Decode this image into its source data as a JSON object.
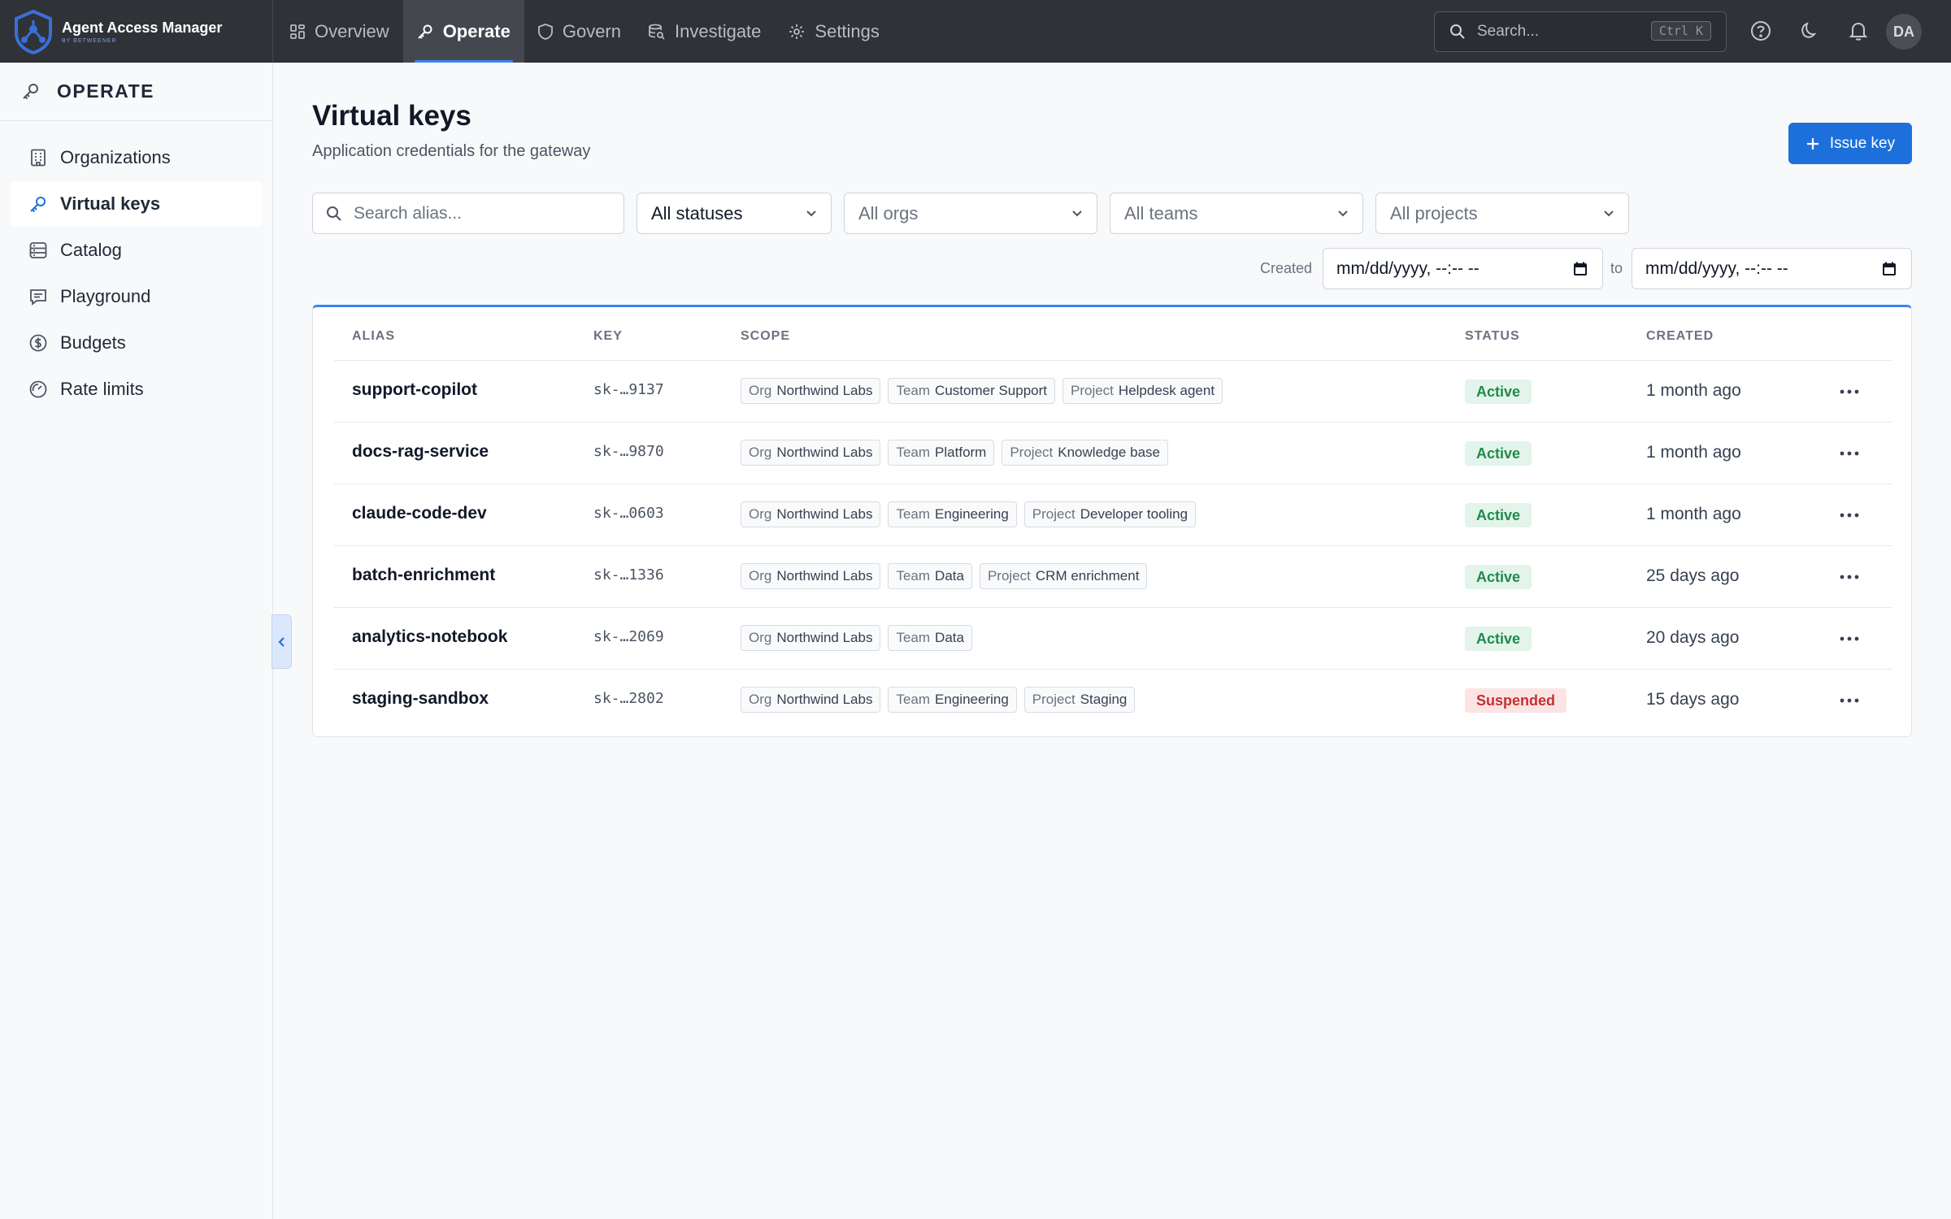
{
  "brand": {
    "name": "Agent Access Manager",
    "sub": "BY BETWEENER"
  },
  "nav": [
    {
      "label": "Overview",
      "icon": "grid-icon"
    },
    {
      "label": "Operate",
      "icon": "key-icon",
      "active": true
    },
    {
      "label": "Govern",
      "icon": "shield-icon"
    },
    {
      "label": "Investigate",
      "icon": "database-search-icon"
    },
    {
      "label": "Settings",
      "icon": "gear-icon"
    }
  ],
  "search": {
    "placeholder": "Search...",
    "shortcut": "Ctrl K"
  },
  "user": {
    "initials": "DA"
  },
  "sidebar": {
    "title": "OPERATE",
    "items": [
      {
        "label": "Organizations",
        "icon": "building-icon"
      },
      {
        "label": "Virtual keys",
        "icon": "key-icon",
        "active": true
      },
      {
        "label": "Catalog",
        "icon": "catalog-icon"
      },
      {
        "label": "Playground",
        "icon": "chat-icon"
      },
      {
        "label": "Budgets",
        "icon": "dollar-icon"
      },
      {
        "label": "Rate limits",
        "icon": "gauge-icon"
      }
    ]
  },
  "page": {
    "title": "Virtual keys",
    "subtitle": "Application credentials for the gateway",
    "issue_button": "Issue key"
  },
  "filters": {
    "search_placeholder": "Search alias...",
    "status": "All statuses",
    "orgs": "All orgs",
    "teams": "All teams",
    "projects": "All projects",
    "created_label": "Created",
    "to_label": "to",
    "date_from": "mm/dd/yyyy, --:-- --",
    "date_to": "mm/dd/yyyy, --:-- --"
  },
  "table": {
    "headers": {
      "alias": "ALIAS",
      "key": "KEY",
      "scope": "SCOPE",
      "status": "STATUS",
      "created": "CREATED"
    },
    "rows": [
      {
        "alias": "support-copilot",
        "key": "sk-…9137",
        "scope": [
          {
            "k": "Org",
            "v": "Northwind Labs"
          },
          {
            "k": "Team",
            "v": "Customer Support"
          },
          {
            "k": "Project",
            "v": "Helpdesk agent"
          }
        ],
        "status": "Active",
        "created": "1 month ago"
      },
      {
        "alias": "docs-rag-service",
        "key": "sk-…9870",
        "scope": [
          {
            "k": "Org",
            "v": "Northwind Labs"
          },
          {
            "k": "Team",
            "v": "Platform"
          },
          {
            "k": "Project",
            "v": "Knowledge base"
          }
        ],
        "status": "Active",
        "created": "1 month ago"
      },
      {
        "alias": "claude-code-dev",
        "key": "sk-…0603",
        "scope": [
          {
            "k": "Org",
            "v": "Northwind Labs"
          },
          {
            "k": "Team",
            "v": "Engineering"
          },
          {
            "k": "Project",
            "v": "Developer tooling"
          }
        ],
        "status": "Active",
        "created": "1 month ago"
      },
      {
        "alias": "batch-enrichment",
        "key": "sk-…1336",
        "scope": [
          {
            "k": "Org",
            "v": "Northwind Labs"
          },
          {
            "k": "Team",
            "v": "Data"
          },
          {
            "k": "Project",
            "v": "CRM enrichment"
          }
        ],
        "status": "Active",
        "created": "25 days ago"
      },
      {
        "alias": "analytics-notebook",
        "key": "sk-…2069",
        "scope": [
          {
            "k": "Org",
            "v": "Northwind Labs"
          },
          {
            "k": "Team",
            "v": "Data"
          }
        ],
        "status": "Active",
        "created": "20 days ago"
      },
      {
        "alias": "staging-sandbox",
        "key": "sk-…2802",
        "scope": [
          {
            "k": "Org",
            "v": "Northwind Labs"
          },
          {
            "k": "Team",
            "v": "Engineering"
          },
          {
            "k": "Project",
            "v": "Staging"
          }
        ],
        "status": "Suspended",
        "created": "15 days ago"
      }
    ]
  },
  "colors": {
    "accent": "#1d6fdc",
    "active": "#1f8a4c",
    "suspended": "#c53030",
    "topbar": "#2f3237"
  }
}
